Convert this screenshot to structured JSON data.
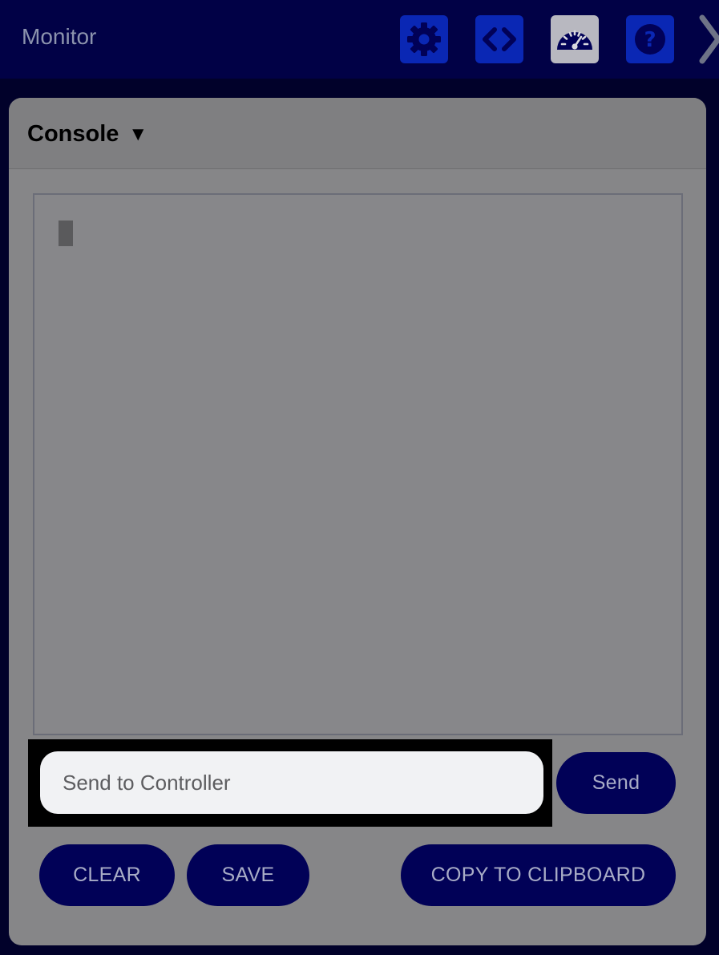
{
  "header": {
    "title": "Monitor",
    "buttons": [
      {
        "icon": "gear-icon",
        "active": false
      },
      {
        "icon": "code-icon",
        "active": false
      },
      {
        "icon": "speedometer-icon",
        "active": true
      },
      {
        "icon": "help-icon",
        "active": false
      }
    ],
    "next_icon": "chevron-right-icon"
  },
  "panel": {
    "title": "Console",
    "caret": "▼"
  },
  "command": {
    "placeholder": "Send to Controller",
    "value": ""
  },
  "actions": {
    "send": "Send",
    "clear": "CLEAR",
    "save": "SAVE",
    "copy": "COPY TO CLIPBOARD"
  },
  "colors": {
    "header_bg": "#010146",
    "page_bg": "#01012a",
    "panel_bg": "#868688",
    "button_bg": "#010157",
    "toolbar_icon_bg": "#0a27b4",
    "toolbar_active_bg": "#b8b8c0"
  }
}
